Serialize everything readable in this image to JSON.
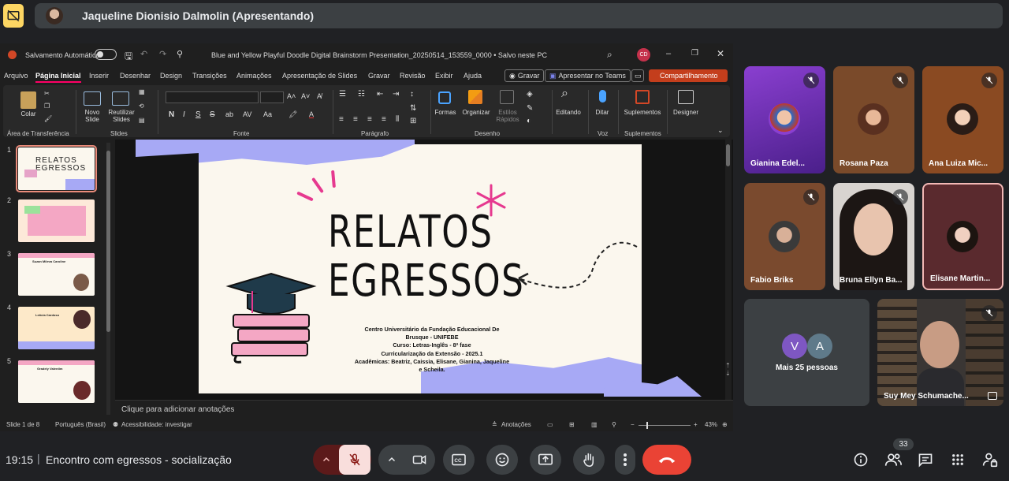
{
  "presenter": {
    "name": "Jaqueline Dionisio Dalmolin (Apresentando)"
  },
  "ppt": {
    "autosave_label": "Salvamento Automático",
    "file_title": "Blue and Yellow Playful Doodle Digital Brainstorm Presentation_20250514_153559_0000 • Salvo neste PC",
    "user_initials": "CD",
    "menu": [
      "Arquivo",
      "Página Inicial",
      "Inserir",
      "Desenhar",
      "Design",
      "Transições",
      "Animações",
      "Apresentação de Slides",
      "Gravar",
      "Revisão",
      "Exibir",
      "Ajuda"
    ],
    "record_label": "Gravar",
    "teams_label": "Apresentar no Teams",
    "share_label": "Compartilhamento",
    "ribbon": {
      "colar": "Colar",
      "novo_slide": "Novo Slide",
      "reutilizar": "Reutilizar Slides",
      "formas": "Formas",
      "organizar": "Organizar",
      "estilos": "Estilos Rápidos",
      "editando": "Editando",
      "ditar": "Ditar",
      "suplementos": "Suplementos",
      "designer": "Designer",
      "groups": {
        "transferencia": "Área de Transferência",
        "slides": "Slides",
        "fonte": "Fonte",
        "paragrafo": "Parágrafo",
        "desenho": "Desenho",
        "voz": "Voz",
        "suplementos": "Suplementos"
      }
    },
    "thumb_numbers": [
      "1",
      "2",
      "3",
      "4",
      "5"
    ],
    "thumb_titles": [
      "RELATOS EGRESSOS",
      "",
      "Suzan Mileva Caroline",
      "Letícia Cardoso",
      "Gradely Valentim"
    ],
    "slide": {
      "title1": "RELATOS",
      "title2": "EGRESSOS",
      "lines": [
        "Centro Universitário da Fundação Educacional De",
        "Brusque - UNIFEBE",
        "Curso: Letras-Inglês - 8ª fase",
        "Curricularização da Extensão - 2025.1",
        "Acadêmicas: Beatriz, Caissia, Elisane, Gianina, Jaqueline",
        "e Scheila."
      ]
    },
    "notes_placeholder": "Clique para adicionar anotações",
    "status": {
      "slide_of": "Slide 1 de 8",
      "language": "Português (Brasil)",
      "accessibility": "Acessibilidade: investigar",
      "notes": "Anotações",
      "zoom": "43%"
    }
  },
  "participants": [
    {
      "name": "Gianina Edel...",
      "bg": "#6a2aa6"
    },
    {
      "name": "Rosana Paza",
      "bg": "#7a4a2a"
    },
    {
      "name": "Ana Luiza Mic...",
      "bg": "#8a4a22"
    },
    {
      "name": "Fabio Briks",
      "bg": "#7a4a2e"
    },
    {
      "name": "Bruna Ellyn Ba...",
      "bg": "#d8d4d0"
    },
    {
      "name": "Elisane Martin...",
      "bg": "#5a2a2e"
    },
    {
      "name": "Suy Mey Schumache...",
      "bg": "#3a3634"
    }
  ],
  "more": {
    "avatar1": "V",
    "avatar2": "A",
    "label": "Mais 25 pessoas"
  },
  "bottom": {
    "time": "19:15",
    "separator": "|",
    "meeting": "Encontro com egressos - socialização",
    "people_count": "33"
  },
  "colors": {
    "accent_yellow": "#fdd663",
    "end_call": "#ea4335",
    "mic_off_bg": "#f9dedc"
  }
}
